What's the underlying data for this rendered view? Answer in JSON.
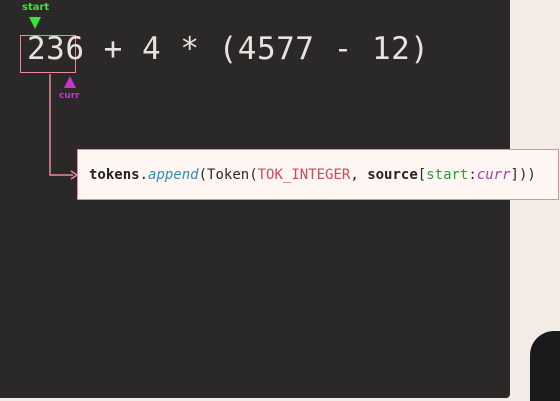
{
  "pointers": {
    "start_label": "start",
    "curr_label": "curr",
    "start_color": "#3ce23c",
    "curr_color": "#c936c9"
  },
  "expression": {
    "token": "236",
    "rest": " + 4 * (4577 - 12)"
  },
  "code": {
    "object": "tokens",
    "dot": ".",
    "method": "append",
    "open_paren": "(",
    "class_name": "Token",
    "open_paren2": "(",
    "constant": "TOK_INTEGER",
    "comma": ", ",
    "variable": "source",
    "open_bracket": "[",
    "slice_start": "start",
    "colon": ":",
    "slice_end": "curr",
    "close": "]))"
  },
  "colors": {
    "panel_bg": "#2a2828",
    "highlight_border": "#e88a9a",
    "code_bg": "#fdf6f2"
  }
}
